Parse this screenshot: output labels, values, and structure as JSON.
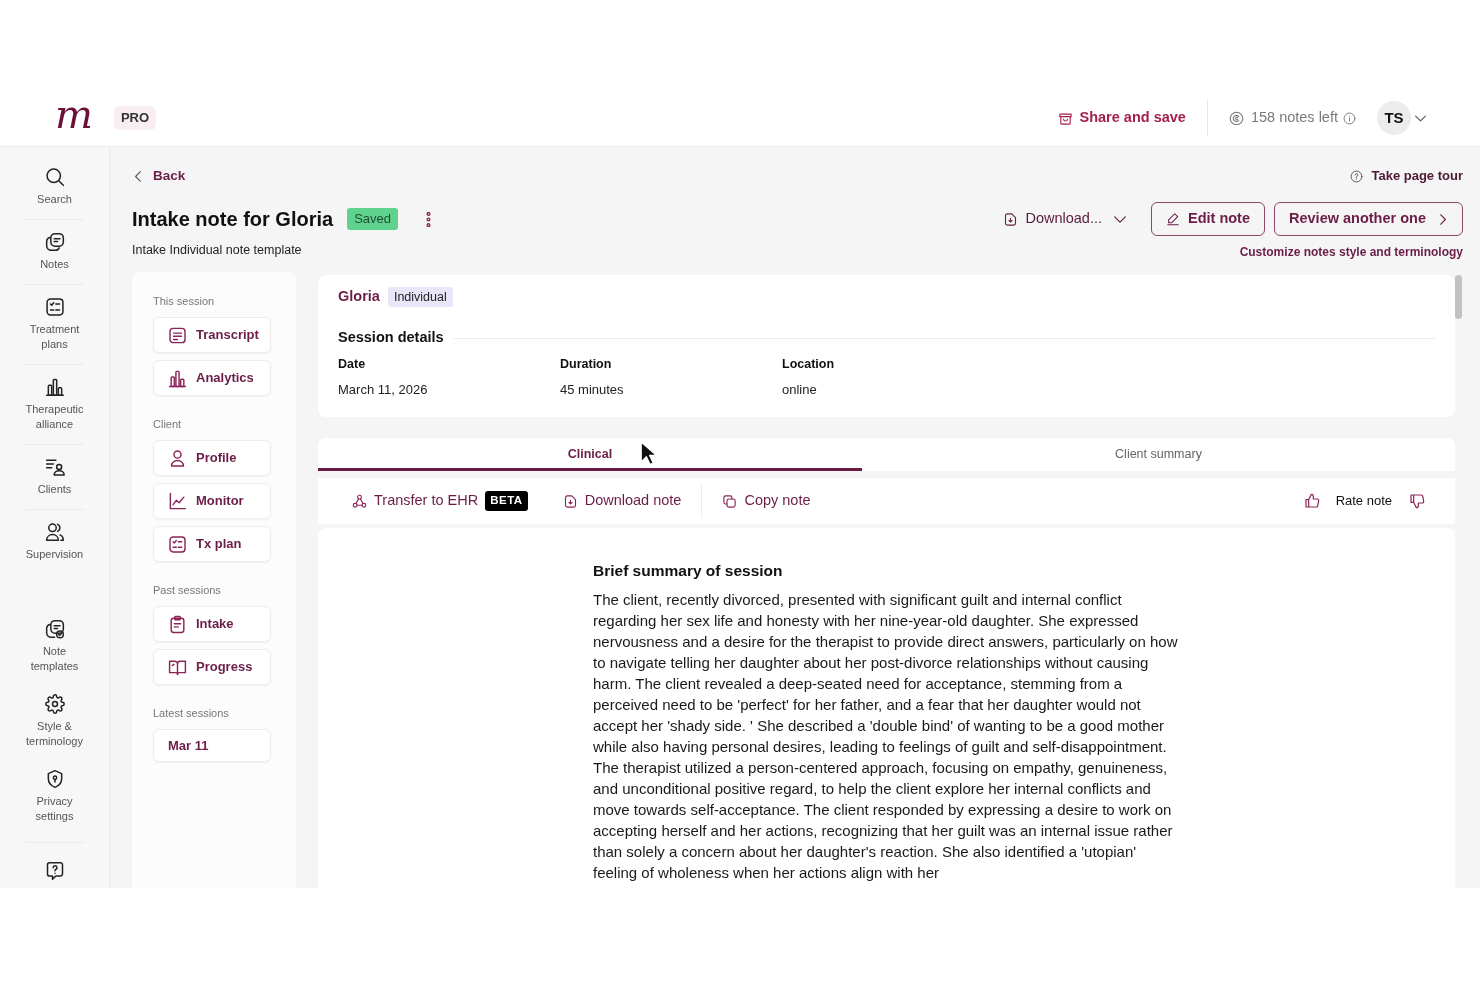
{
  "header": {
    "logo": "m",
    "plan_badge": "PRO",
    "share_button": "Share and save",
    "notes_left": "158 notes left",
    "avatar_initials": "TS"
  },
  "sidebar": {
    "items": [
      {
        "label": "Search"
      },
      {
        "label": "Notes"
      },
      {
        "label": "Treatment plans"
      },
      {
        "label": "Therapeutic alliance"
      },
      {
        "label": "Clients"
      },
      {
        "label": "Supervision"
      }
    ],
    "bottom_items": [
      {
        "label": "Note templates"
      },
      {
        "label": "Style & terminology"
      },
      {
        "label": "Privacy settings"
      }
    ]
  },
  "page": {
    "back_link": "Back",
    "page_tour_link": "Take page tour",
    "title": "Intake note for Gloria",
    "status_badge": "Saved",
    "subtitle": "Intake Individual note template",
    "download_menu": "Download...",
    "edit_button": "Edit note",
    "review_button": "Review another one",
    "customize_link": "Customize notes style and terminology"
  },
  "session_nav": {
    "sections": [
      {
        "title": "This session",
        "items": [
          {
            "label": "Transcript"
          },
          {
            "label": "Analytics"
          }
        ]
      },
      {
        "title": "Client",
        "items": [
          {
            "label": "Profile"
          },
          {
            "label": "Monitor"
          },
          {
            "label": "Tx plan"
          }
        ]
      },
      {
        "title": "Past sessions",
        "items": [
          {
            "label": "Intake"
          },
          {
            "label": "Progress"
          }
        ]
      },
      {
        "title": "Latest sessions",
        "items": [
          {
            "label": "Mar 11"
          }
        ]
      }
    ]
  },
  "session": {
    "client_name": "Gloria",
    "session_type": "Individual",
    "heading": "Session details",
    "fields": [
      {
        "label": "Date",
        "value": "March 11, 2026"
      },
      {
        "label": "Duration",
        "value": "45 minutes"
      },
      {
        "label": "Location",
        "value": "online"
      }
    ]
  },
  "tabs": [
    {
      "label": "Clinical",
      "selected": true
    },
    {
      "label": "Client summary",
      "selected": false
    }
  ],
  "toolbar": {
    "groups": [
      {
        "actions": [
          {
            "label": "Transfer to EHR",
            "badge": "BETA"
          },
          {
            "label": "Download note"
          }
        ]
      },
      {
        "actions": [
          {
            "label": "Copy note"
          }
        ]
      }
    ],
    "rating_label": "Rate note"
  },
  "note": {
    "sections": [
      {
        "heading": "Brief summary of session",
        "text": "The client, recently divorced, presented with significant guilt and internal conflict regarding her sex life and honesty with her nine-year-old daughter. She expressed nervousness and a desire for the therapist to provide direct answers, particularly on how to navigate telling her daughter about her post-divorce relationships without causing harm. The client revealed a deep-seated need for acceptance, stemming from a perceived need to be 'perfect' for her father, and a fear that her daughter would not accept her 'shady side. ' She described a 'double bind' of wanting to be a good mother while also having personal desires, leading to feelings of guilt and self-disappointment. The therapist utilized a person-centered approach, focusing on empathy, genuineness, and unconditional positive regard, to help the client explore her internal conflicts and move towards self-acceptance. The client responded by expressing a desire to work on accepting herself and her actions, recognizing that her guilt was an internal issue rather than solely a concern about her daughter's reaction. She also identified a 'utopian' feeling of wholeness when her actions align with her"
      }
    ]
  }
}
